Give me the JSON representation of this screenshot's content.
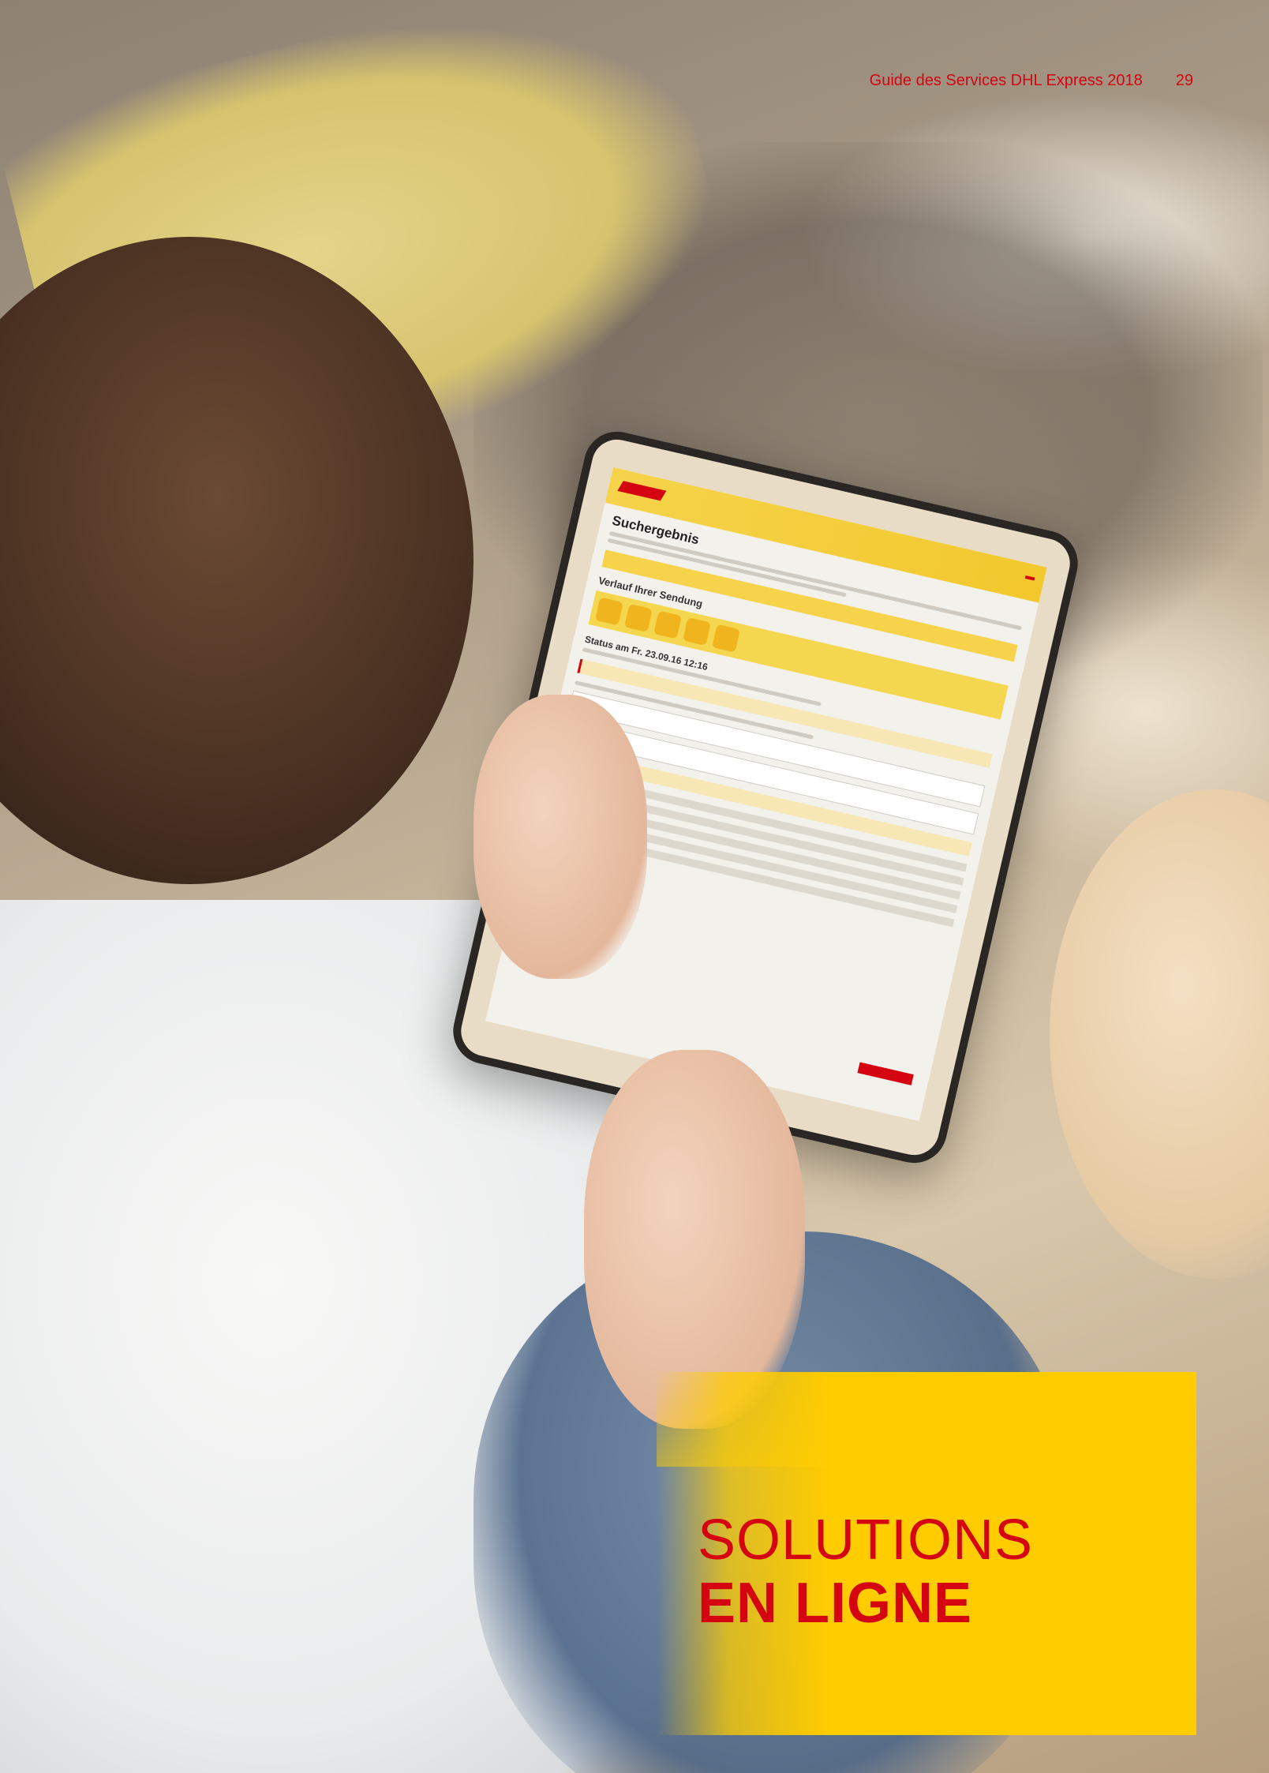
{
  "header": {
    "running_title": "Guide des Services DHL Express 2018",
    "page_number": "29"
  },
  "heading": {
    "line1": "SOLUTIONS",
    "line2": "EN LIGNE"
  },
  "tablet_screen": {
    "title": "Suchergebnis",
    "subtitle": "Verlauf Ihrer Sendung",
    "status": "Status am Fr. 23.09.16 12:16"
  },
  "colors": {
    "brand_red": "#d40511",
    "brand_yellow": "#ffcc00"
  }
}
